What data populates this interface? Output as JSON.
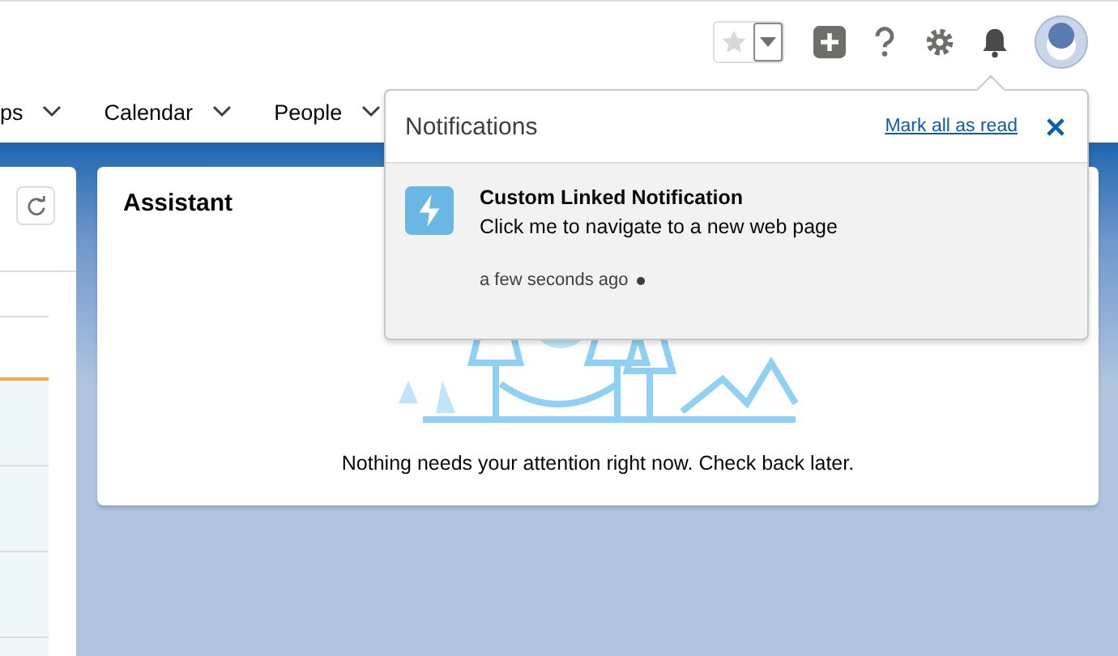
{
  "header": {
    "favorite": {
      "selected": false
    }
  },
  "nav": {
    "tabs": [
      {
        "label": "ps"
      },
      {
        "label": "Calendar"
      },
      {
        "label": "People"
      }
    ]
  },
  "assistant": {
    "title": "Assistant",
    "empty_message": "Nothing needs your attention right now. Check back later."
  },
  "notifications": {
    "title": "Notifications",
    "mark_all": "Mark all as read",
    "items": [
      {
        "title": "Custom Linked Notification",
        "body": "Click me to navigate to a new web page",
        "time": "a few seconds ago",
        "unread": true
      }
    ]
  }
}
